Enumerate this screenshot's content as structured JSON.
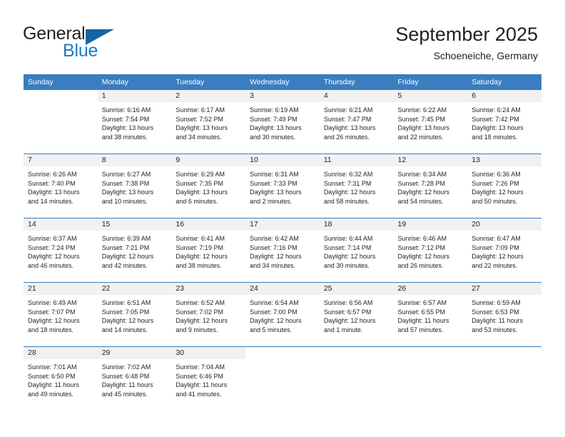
{
  "brand": {
    "name_part1": "General",
    "name_part2": "Blue",
    "triangle_color": "#1464a5",
    "blue_text_color": "#1b7ac2"
  },
  "header": {
    "title": "September 2025",
    "subtitle": "Schoeneiche, Germany"
  },
  "calendar": {
    "header_bg": "#3a7dc0",
    "daynum_bg": "#f1f1f1",
    "weekdays": [
      "Sunday",
      "Monday",
      "Tuesday",
      "Wednesday",
      "Thursday",
      "Friday",
      "Saturday"
    ],
    "weeks": [
      [
        {
          "day": "",
          "blank": true
        },
        {
          "day": "1",
          "sunrise": "Sunrise: 6:16 AM",
          "sunset": "Sunset: 7:54 PM",
          "daylight_line1": "Daylight: 13 hours",
          "daylight_line2": "and 38 minutes."
        },
        {
          "day": "2",
          "sunrise": "Sunrise: 6:17 AM",
          "sunset": "Sunset: 7:52 PM",
          "daylight_line1": "Daylight: 13 hours",
          "daylight_line2": "and 34 minutes."
        },
        {
          "day": "3",
          "sunrise": "Sunrise: 6:19 AM",
          "sunset": "Sunset: 7:49 PM",
          "daylight_line1": "Daylight: 13 hours",
          "daylight_line2": "and 30 minutes."
        },
        {
          "day": "4",
          "sunrise": "Sunrise: 6:21 AM",
          "sunset": "Sunset: 7:47 PM",
          "daylight_line1": "Daylight: 13 hours",
          "daylight_line2": "and 26 minutes."
        },
        {
          "day": "5",
          "sunrise": "Sunrise: 6:22 AM",
          "sunset": "Sunset: 7:45 PM",
          "daylight_line1": "Daylight: 13 hours",
          "daylight_line2": "and 22 minutes."
        },
        {
          "day": "6",
          "sunrise": "Sunrise: 6:24 AM",
          "sunset": "Sunset: 7:42 PM",
          "daylight_line1": "Daylight: 13 hours",
          "daylight_line2": "and 18 minutes."
        }
      ],
      [
        {
          "day": "7",
          "sunrise": "Sunrise: 6:26 AM",
          "sunset": "Sunset: 7:40 PM",
          "daylight_line1": "Daylight: 13 hours",
          "daylight_line2": "and 14 minutes."
        },
        {
          "day": "8",
          "sunrise": "Sunrise: 6:27 AM",
          "sunset": "Sunset: 7:38 PM",
          "daylight_line1": "Daylight: 13 hours",
          "daylight_line2": "and 10 minutes."
        },
        {
          "day": "9",
          "sunrise": "Sunrise: 6:29 AM",
          "sunset": "Sunset: 7:35 PM",
          "daylight_line1": "Daylight: 13 hours",
          "daylight_line2": "and 6 minutes."
        },
        {
          "day": "10",
          "sunrise": "Sunrise: 6:31 AM",
          "sunset": "Sunset: 7:33 PM",
          "daylight_line1": "Daylight: 13 hours",
          "daylight_line2": "and 2 minutes."
        },
        {
          "day": "11",
          "sunrise": "Sunrise: 6:32 AM",
          "sunset": "Sunset: 7:31 PM",
          "daylight_line1": "Daylight: 12 hours",
          "daylight_line2": "and 58 minutes."
        },
        {
          "day": "12",
          "sunrise": "Sunrise: 6:34 AM",
          "sunset": "Sunset: 7:28 PM",
          "daylight_line1": "Daylight: 12 hours",
          "daylight_line2": "and 54 minutes."
        },
        {
          "day": "13",
          "sunrise": "Sunrise: 6:36 AM",
          "sunset": "Sunset: 7:26 PM",
          "daylight_line1": "Daylight: 12 hours",
          "daylight_line2": "and 50 minutes."
        }
      ],
      [
        {
          "day": "14",
          "sunrise": "Sunrise: 6:37 AM",
          "sunset": "Sunset: 7:24 PM",
          "daylight_line1": "Daylight: 12 hours",
          "daylight_line2": "and 46 minutes."
        },
        {
          "day": "15",
          "sunrise": "Sunrise: 6:39 AM",
          "sunset": "Sunset: 7:21 PM",
          "daylight_line1": "Daylight: 12 hours",
          "daylight_line2": "and 42 minutes."
        },
        {
          "day": "16",
          "sunrise": "Sunrise: 6:41 AM",
          "sunset": "Sunset: 7:19 PM",
          "daylight_line1": "Daylight: 12 hours",
          "daylight_line2": "and 38 minutes."
        },
        {
          "day": "17",
          "sunrise": "Sunrise: 6:42 AM",
          "sunset": "Sunset: 7:16 PM",
          "daylight_line1": "Daylight: 12 hours",
          "daylight_line2": "and 34 minutes."
        },
        {
          "day": "18",
          "sunrise": "Sunrise: 6:44 AM",
          "sunset": "Sunset: 7:14 PM",
          "daylight_line1": "Daylight: 12 hours",
          "daylight_line2": "and 30 minutes."
        },
        {
          "day": "19",
          "sunrise": "Sunrise: 6:46 AM",
          "sunset": "Sunset: 7:12 PM",
          "daylight_line1": "Daylight: 12 hours",
          "daylight_line2": "and 26 minutes."
        },
        {
          "day": "20",
          "sunrise": "Sunrise: 6:47 AM",
          "sunset": "Sunset: 7:09 PM",
          "daylight_line1": "Daylight: 12 hours",
          "daylight_line2": "and 22 minutes."
        }
      ],
      [
        {
          "day": "21",
          "sunrise": "Sunrise: 6:49 AM",
          "sunset": "Sunset: 7:07 PM",
          "daylight_line1": "Daylight: 12 hours",
          "daylight_line2": "and 18 minutes."
        },
        {
          "day": "22",
          "sunrise": "Sunrise: 6:51 AM",
          "sunset": "Sunset: 7:05 PM",
          "daylight_line1": "Daylight: 12 hours",
          "daylight_line2": "and 14 minutes."
        },
        {
          "day": "23",
          "sunrise": "Sunrise: 6:52 AM",
          "sunset": "Sunset: 7:02 PM",
          "daylight_line1": "Daylight: 12 hours",
          "daylight_line2": "and 9 minutes."
        },
        {
          "day": "24",
          "sunrise": "Sunrise: 6:54 AM",
          "sunset": "Sunset: 7:00 PM",
          "daylight_line1": "Daylight: 12 hours",
          "daylight_line2": "and 5 minutes."
        },
        {
          "day": "25",
          "sunrise": "Sunrise: 6:56 AM",
          "sunset": "Sunset: 6:57 PM",
          "daylight_line1": "Daylight: 12 hours",
          "daylight_line2": "and 1 minute."
        },
        {
          "day": "26",
          "sunrise": "Sunrise: 6:57 AM",
          "sunset": "Sunset: 6:55 PM",
          "daylight_line1": "Daylight: 11 hours",
          "daylight_line2": "and 57 minutes."
        },
        {
          "day": "27",
          "sunrise": "Sunrise: 6:59 AM",
          "sunset": "Sunset: 6:53 PM",
          "daylight_line1": "Daylight: 11 hours",
          "daylight_line2": "and 53 minutes."
        }
      ],
      [
        {
          "day": "28",
          "sunrise": "Sunrise: 7:01 AM",
          "sunset": "Sunset: 6:50 PM",
          "daylight_line1": "Daylight: 11 hours",
          "daylight_line2": "and 49 minutes."
        },
        {
          "day": "29",
          "sunrise": "Sunrise: 7:02 AM",
          "sunset": "Sunset: 6:48 PM",
          "daylight_line1": "Daylight: 11 hours",
          "daylight_line2": "and 45 minutes."
        },
        {
          "day": "30",
          "sunrise": "Sunrise: 7:04 AM",
          "sunset": "Sunset: 6:46 PM",
          "daylight_line1": "Daylight: 11 hours",
          "daylight_line2": "and 41 minutes."
        },
        {
          "day": "",
          "blank": true
        },
        {
          "day": "",
          "blank": true
        },
        {
          "day": "",
          "blank": true
        },
        {
          "day": "",
          "blank": true
        }
      ]
    ]
  }
}
